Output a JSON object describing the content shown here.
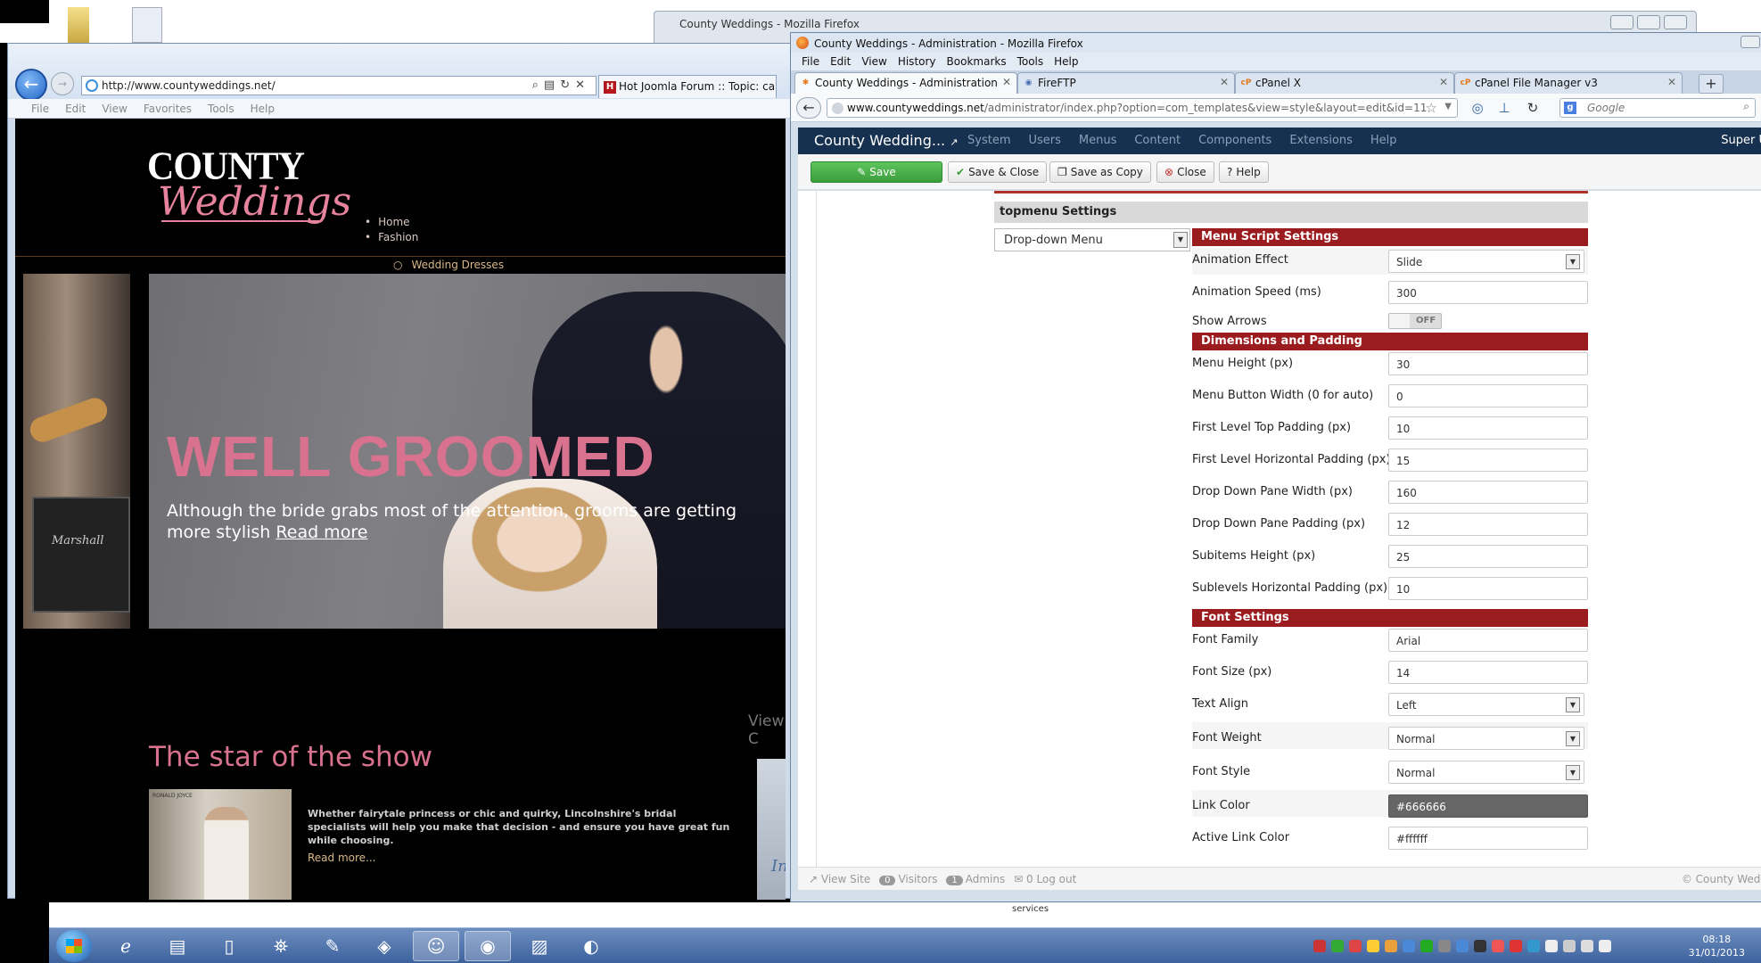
{
  "background_window": {
    "title": "County Weddings - Mozilla Firefox"
  },
  "ie": {
    "address": "http://www.countyweddings.net/",
    "tab_title": "Hot Joomla Forum :: Topic: ca...",
    "menu": [
      "File",
      "Edit",
      "View",
      "Favorites",
      "Tools",
      "Help"
    ]
  },
  "site": {
    "logo_top": "COUNTY",
    "logo_bottom": "Weddings",
    "nav": [
      "Home",
      "Fashion"
    ],
    "nav_sub": "Wedding Dresses",
    "amp_brand": "Marshall",
    "hero_title": "WELL GROOMED",
    "hero_text": "Although the bride grabs most of the attention, grooms are getting more stylish",
    "hero_link": "Read more",
    "view_label": "View C",
    "star_title": "The star of the show",
    "star_image_label": "RONALD JOYCE",
    "star_text": "Whether fairytale princess or chic and quirky, Lincolnshire's bridal specialists will help you make that decision - and ensure you have great fun while choosing.",
    "star_more": "Read more...",
    "right_thumb_text": "Ini"
  },
  "firefox": {
    "title": "County Weddings - Administration - Mozilla Firefox",
    "menu": [
      "File",
      "Edit",
      "View",
      "History",
      "Bookmarks",
      "Tools",
      "Help"
    ],
    "tabs": [
      {
        "label": "County Weddings - Administration",
        "icon": "joomla-icon",
        "active": true
      },
      {
        "label": "FireFTP",
        "icon": "fireftp-icon",
        "active": false
      },
      {
        "label": "cPanel X",
        "icon": "cpanel-icon",
        "active": false
      },
      {
        "label": "cPanel File Manager v3",
        "icon": "cpanel-icon",
        "active": false
      }
    ],
    "url_domain": "www.countyweddings.net",
    "url_path": "/administrator/index.php?option=com_templates&view=style&layout=edit&id=11",
    "search_placeholder": "Google"
  },
  "joomla": {
    "brand": "County Wedding...",
    "nav": [
      "System",
      "Users",
      "Menus",
      "Content",
      "Components",
      "Extensions",
      "Help"
    ],
    "user_menu": "Super U",
    "toolbar": {
      "save": "Save",
      "save_close": "Save & Close",
      "save_copy": "Save as Copy",
      "close": "Close",
      "help": "Help"
    },
    "section_title": "topmenu Settings",
    "menu_type": "Drop-down Menu",
    "groups": {
      "script": "Menu Script Settings",
      "dimensions": "Dimensions and Padding",
      "font": "Font Settings"
    },
    "script_fields": {
      "animation_effect": {
        "label": "Animation Effect",
        "value": "Slide"
      },
      "animation_speed": {
        "label": "Animation Speed (ms)",
        "value": "300"
      },
      "show_arrows": {
        "label": "Show Arrows",
        "value": "OFF"
      }
    },
    "dimension_fields": [
      {
        "label": "Menu Height (px)",
        "value": "30"
      },
      {
        "label": "Menu Button Width (0 for auto)",
        "value": "0"
      },
      {
        "label": "First Level Top Padding (px)",
        "value": "10"
      },
      {
        "label": "First Level Horizontal Padding (px)",
        "value": "15"
      },
      {
        "label": "Drop Down Pane Width (px)",
        "value": "160"
      },
      {
        "label": "Drop Down Pane Padding (px)",
        "value": "12"
      },
      {
        "label": "Subitems Height (px)",
        "value": "25"
      },
      {
        "label": "Sublevels Horizontal Padding (px)",
        "value": "10"
      }
    ],
    "font_fields": {
      "family": {
        "label": "Font Family",
        "value": "Arial"
      },
      "size": {
        "label": "Font Size (px)",
        "value": "14"
      },
      "align": {
        "label": "Text Align",
        "value": "Left"
      },
      "weight": {
        "label": "Font Weight",
        "value": "Normal"
      },
      "style": {
        "label": "Font Style",
        "value": "Normal"
      },
      "link_color": {
        "label": "Link Color",
        "value": "#666666"
      },
      "active_link_color": {
        "label": "Active Link Color",
        "value": "#ffffff"
      }
    },
    "footer": {
      "view_site": "View Site",
      "visitors_count": "0",
      "visitors": "Visitors",
      "admins_count": "1",
      "admins": "Admins",
      "messages_count": "0",
      "logout": "Log out",
      "copyright": "© County Wedd"
    }
  },
  "below_strip_text": "services",
  "taskbar": {
    "time": "08:18",
    "date": "31/01/2013"
  },
  "colors": {
    "joomla_header": "#16304f",
    "group_red": "#9b1c1f",
    "save_green": "#3a9e3a",
    "site_pink": "#d9728f"
  }
}
